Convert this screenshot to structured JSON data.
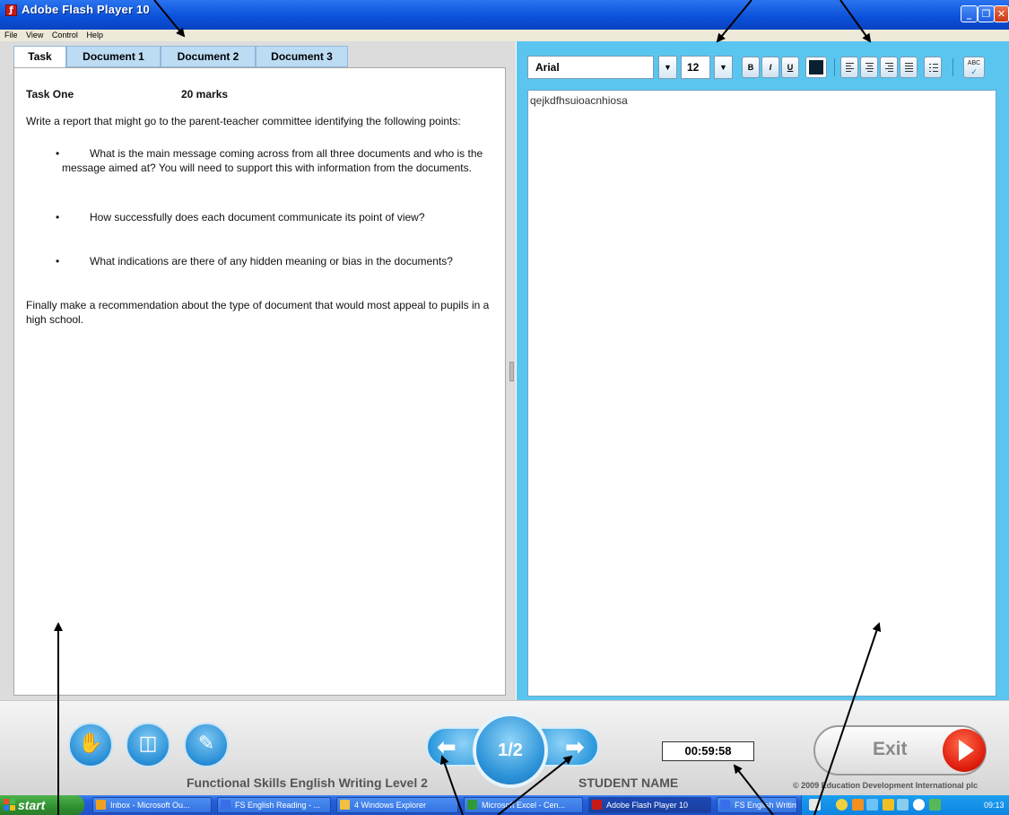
{
  "window": {
    "title": "Adobe Flash Player 10",
    "app_icon_glyph": "ƒ",
    "controls": {
      "minimize": "_",
      "maximize": "❐",
      "close": "✕"
    }
  },
  "menu": [
    "File",
    "View",
    "Control",
    "Help"
  ],
  "tabs": [
    "Task",
    "Document 1",
    "Document 2",
    "Document 3"
  ],
  "task": {
    "title": "Task One",
    "marks": "20 marks",
    "intro": "Write a report that might go to the parent-teacher committee identifying the following points:",
    "bullets": [
      "What is the main message coming across from all three documents and who is the message aimed at?  You will need to support this with information from the documents.",
      "How successfully does each document communicate its point of view?",
      "What indications are there of any hidden meaning or bias in the documents?"
    ],
    "bullet_char": "•",
    "final": "Finally make a recommendation about the type of document that would most appeal to pupils in a high school."
  },
  "editor": {
    "font": "Arial",
    "size": "12",
    "bold": "B",
    "italic": "I",
    "underline": "U",
    "spell": "ABC",
    "text_color": "#0a2030",
    "dropdown_glyph": "▼",
    "content": "qejkdfhsuioacnhiosa"
  },
  "footer": {
    "page": "1/2",
    "prev_glyph": "⬅",
    "next_glyph": "➡",
    "timer": "00:59:58",
    "exit": "Exit",
    "course_title": "Functional Skills English Writing Level 2",
    "student": "STUDENT NAME",
    "copyright": "© 2009 Education Development International plc",
    "tool_buttons": [
      "hand-icon",
      "layout-icon",
      "pencil-icon"
    ],
    "tool_glyphs": [
      "✋",
      "◫",
      "✎"
    ]
  },
  "taskbar": {
    "start": "start",
    "items": [
      {
        "label": "Inbox - Microsoft Ou...",
        "icon_color": "#f0a020"
      },
      {
        "label": "FS English Reading - ...",
        "icon_color": "#3a6ee8"
      },
      {
        "label": "4 Windows Explorer",
        "icon_color": "#f0c040"
      },
      {
        "label": "Microsoft Excel - Cen...",
        "icon_color": "#2f9a3a"
      },
      {
        "label": "Adobe Flash Player 10",
        "icon_color": "#c81818"
      },
      {
        "label": "FS English Writing (F...",
        "icon_color": "#3a6ee8"
      }
    ],
    "time": "09:13"
  },
  "colors": {
    "titlebar": "#0a4fd8",
    "right_panel": "#5ac5ef",
    "tab": "#bcdcf4",
    "accent_button": "#2a8fd6",
    "exit_red": "#e01e0e"
  }
}
